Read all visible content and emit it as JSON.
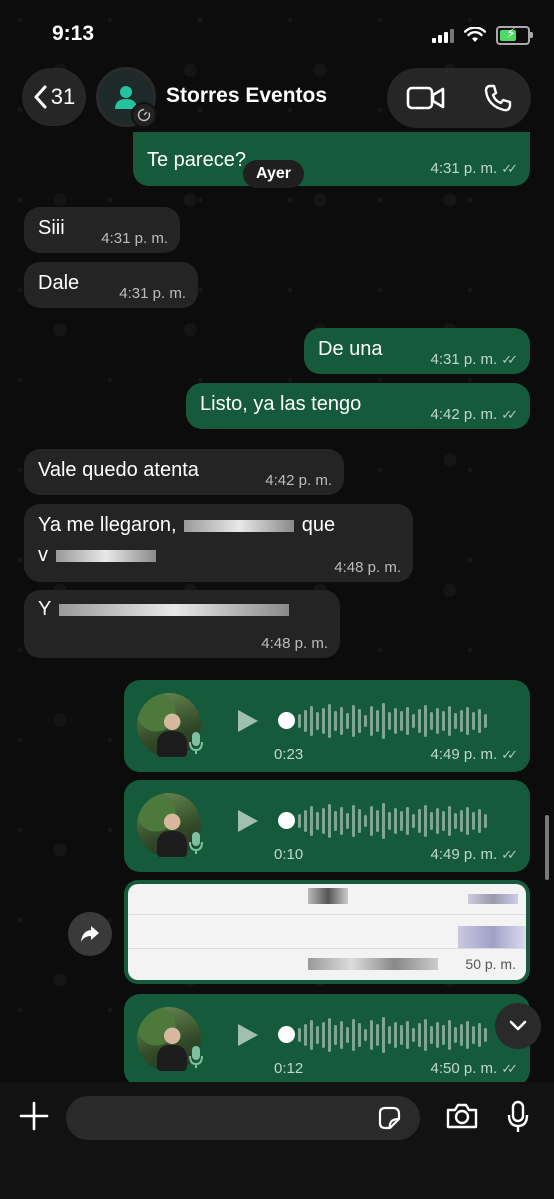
{
  "status_bar": {
    "time": "9:13"
  },
  "header": {
    "back_count": "31",
    "contact_name": "Storres Eventos"
  },
  "day_separator": "Ayer",
  "messages": [
    {
      "direction": "out",
      "text": "Te parece?",
      "time": "4:31 p. m."
    },
    {
      "direction": "in",
      "text": "Siii",
      "time": "4:31 p. m."
    },
    {
      "direction": "in",
      "text": "Dale",
      "time": "4:31 p. m."
    },
    {
      "direction": "out",
      "text": "De una",
      "time": "4:31 p. m."
    },
    {
      "direction": "out",
      "text": "Listo, ya las tengo",
      "time": "4:42 p. m."
    },
    {
      "direction": "in",
      "text": "Vale quedo atenta",
      "time": "4:42 p. m."
    },
    {
      "direction": "in",
      "text_line1_start": "Ya me llegaron,",
      "text_line1_end": "que",
      "text_line2_start": "v",
      "time": "4:48 p. m."
    },
    {
      "direction": "in",
      "text_start": "Y",
      "time": "4:48 p. m."
    }
  ],
  "voice_notes": [
    {
      "duration": "0:23",
      "time": "4:49 p. m."
    },
    {
      "duration": "0:10",
      "time": "4:49 p. m."
    },
    {
      "duration": "0:12",
      "time": "4:50 p. m."
    }
  ],
  "attachment": {
    "time_fragment": "50 p. m."
  },
  "input": {
    "placeholder": ""
  },
  "colors": {
    "outgoing_bubble": "#155a3b",
    "incoming_bubble": "#242424",
    "avatar_accent": "#25c2a0",
    "battery": "#4cd964"
  },
  "icons": [
    "back-chevron-icon",
    "person-icon",
    "video-call-icon",
    "phone-icon",
    "play-icon",
    "mic-icon",
    "forward-icon",
    "chevron-down-icon",
    "plus-icon",
    "sticker-icon",
    "camera-icon"
  ]
}
